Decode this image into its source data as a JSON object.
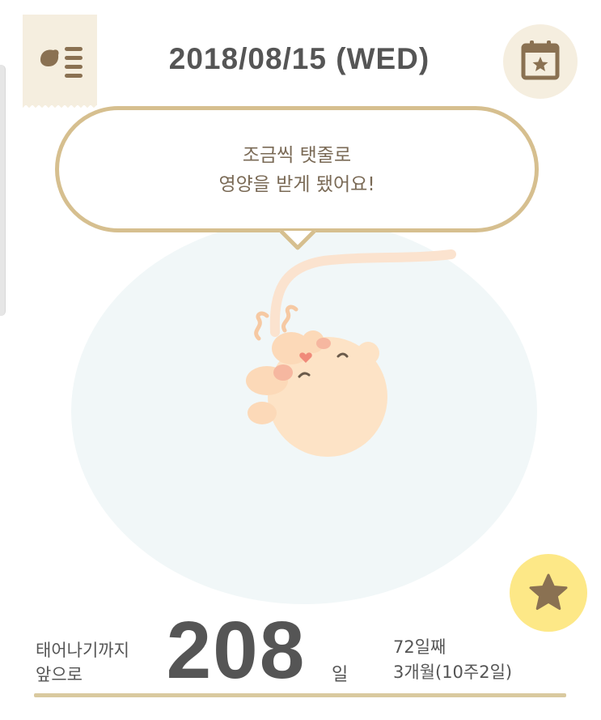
{
  "header": {
    "date": "2018/08/15 (WED)",
    "menu_icon": "menu-list-icon",
    "calendar_icon": "calendar-star-icon"
  },
  "message": {
    "line1": "조금씩 탯줄로",
    "line2": "영양을 받게 됐어요!"
  },
  "countdown": {
    "label_line1": "태어나기까지",
    "label_line2": "앞으로",
    "days_remaining": "208",
    "unit": "일"
  },
  "progress": {
    "day_count": "72일째",
    "month_week": "3개월(10주2일)"
  },
  "favorite_icon": "star-icon",
  "colors": {
    "accent_gold": "#d6bf8f",
    "cream": "#f5eedf",
    "star_yellow": "#fde887",
    "icon_brown": "#8a7152",
    "text_gray": "#555555",
    "womb_blue": "#f1f7f8"
  }
}
